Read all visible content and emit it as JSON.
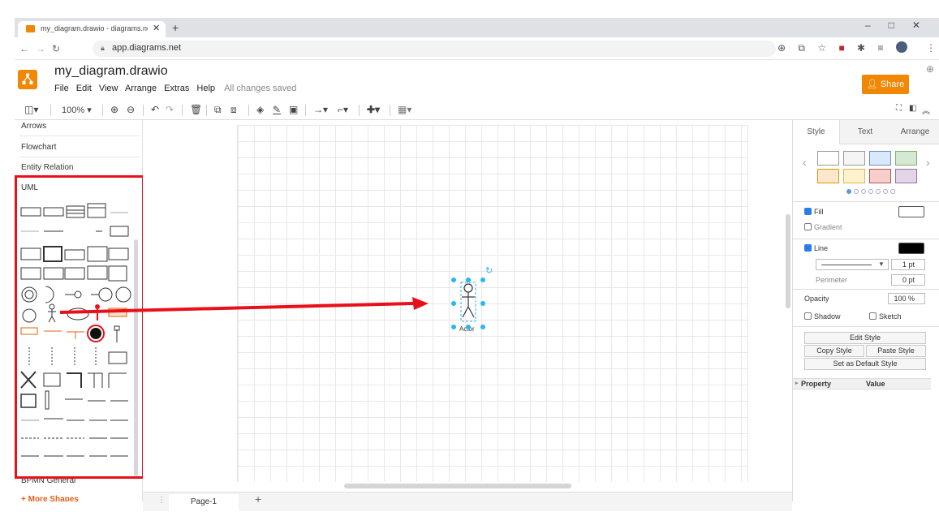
{
  "browser": {
    "tab_title": "my_diagram.drawio - diagrams.net",
    "tab_close": "✕",
    "new_tab": "+",
    "window_controls": "–□✕",
    "url": "app.diagrams.net"
  },
  "app": {
    "doc_title": "my_diagram.drawio",
    "menus": [
      "File",
      "Edit",
      "View",
      "Arrange",
      "Extras",
      "Help"
    ],
    "save_status": "All changes saved",
    "share_label": "Share"
  },
  "toolbar": {
    "zoom": "100%"
  },
  "sidebar": {
    "categories": [
      "Arrows",
      "Flowchart",
      "Entity Relation",
      "UML"
    ],
    "bottom_category": "BPMN General",
    "more_shapes": "+ More Shapes"
  },
  "canvas": {
    "actor_label": "Actor",
    "page_tab": "Page-1",
    "add_page": "+"
  },
  "format_panel": {
    "tabs": [
      "Style",
      "Text",
      "Arrange"
    ],
    "swatch_colors": [
      "#ffffff",
      "#f5f5f5",
      "#dae8fc",
      "#d5e8d4",
      "#ffe6cc",
      "#fff2cc",
      "#f8cecc",
      "#e1d5e7"
    ],
    "fill_label": "Fill",
    "gradient_label": "Gradient",
    "line_label": "Line",
    "line_width": "1 pt",
    "perimeter_label": "Perimeter",
    "perimeter_value": "0 pt",
    "opacity_label": "Opacity",
    "opacity_value": "100 %",
    "shadow_label": "Shadow",
    "sketch_label": "Sketch",
    "edit_style": "Edit Style",
    "copy_style": "Copy Style",
    "paste_style": "Paste Style",
    "set_default_style": "Set as Default Style",
    "property_header": "Property",
    "value_header": "Value"
  },
  "colors": {
    "accent": "#f08705",
    "selection": "#29b6f2",
    "annotation_red": "#e8101a"
  }
}
